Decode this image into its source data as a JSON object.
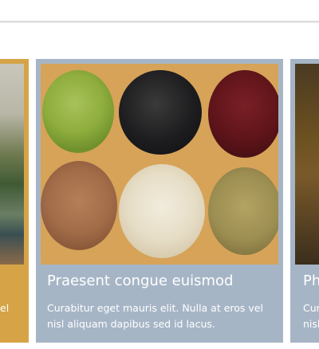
{
  "cards": {
    "left": {
      "text": "el"
    },
    "main": {
      "title": "Praesent congue euismod",
      "text": "Curabitur eget mauris elit. Nulla at eros vel nisl aliquam dapibus sed id lacus."
    },
    "right": {
      "title": "Ph",
      "text": "Cur nisl"
    }
  },
  "colors": {
    "left_card_bg": "#d6a447",
    "main_card_bg": "#a6b5c6",
    "image_board": "#d6a358"
  },
  "image": {
    "subject": "beans-and-grains-photo"
  }
}
